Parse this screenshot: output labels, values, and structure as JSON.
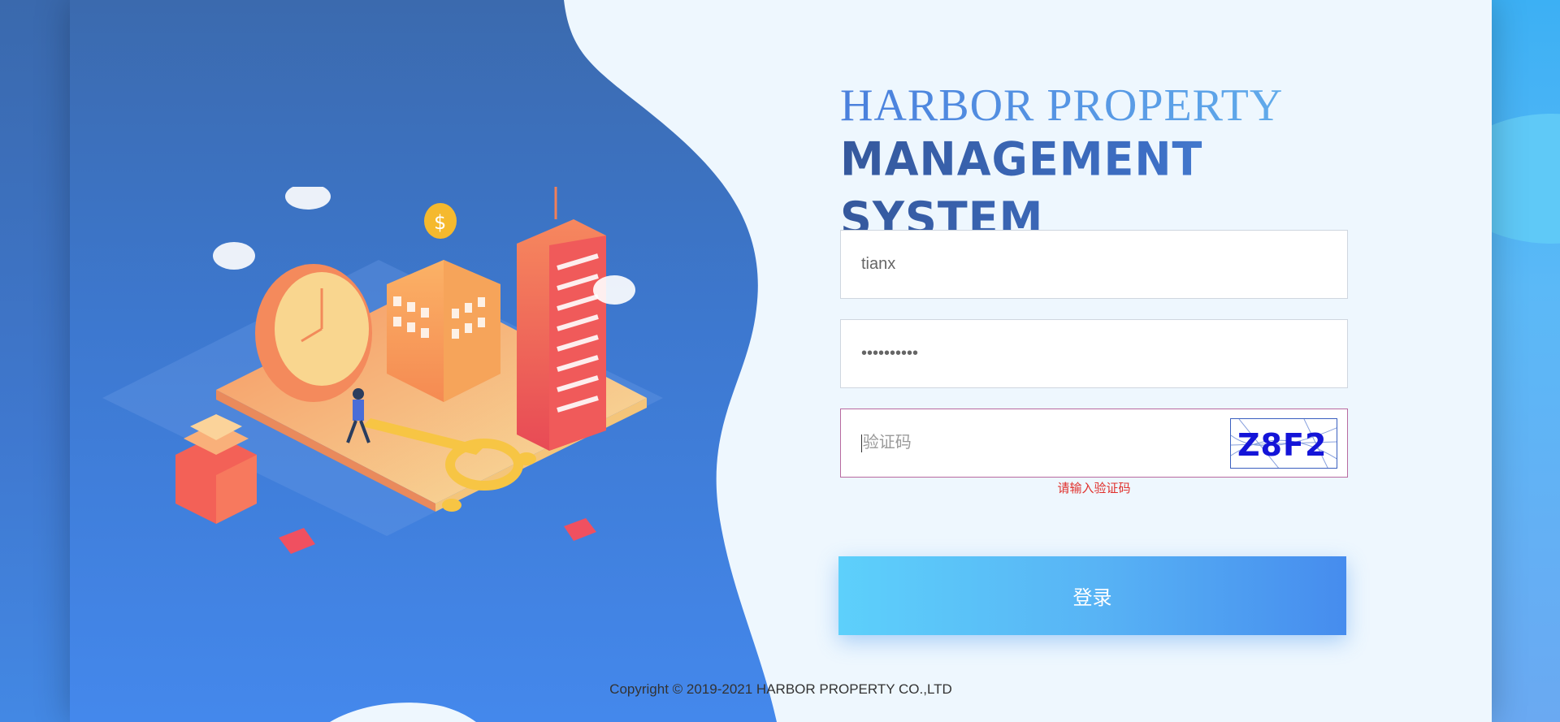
{
  "brand": {
    "line1": "HARBOR PROPERTY",
    "line2_a": "MANAGEMENT",
    "line2_b": "SYSTEM"
  },
  "form": {
    "username_value": "tianx",
    "password_value": "••••••••••",
    "captcha_placeholder": "验证码",
    "captcha_code": "Z8F2",
    "captcha_error": "请输入验证码",
    "submit_label": "登录"
  },
  "footer": {
    "copyright": "Copyright © 2019-2021 HARBOR PROPERTY CO.,LTD"
  },
  "colors": {
    "accent": "#468cee",
    "button_start": "#5dd0fb",
    "error": "#e0302c",
    "panel_bg": "#eef7fe"
  },
  "icons": [
    "cloud-icon",
    "clock-icon",
    "coin-icon",
    "key-icon",
    "person-icon",
    "building-icon"
  ]
}
